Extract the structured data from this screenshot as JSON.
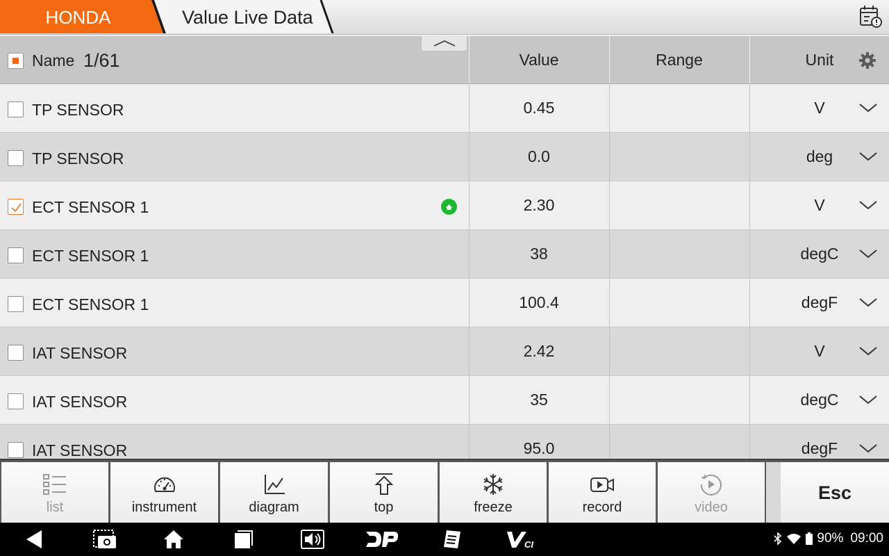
{
  "header": {
    "brand": "HONDA",
    "title": "Value Live Data"
  },
  "table": {
    "columns": {
      "name": "Name",
      "count": "1/61",
      "value": "Value",
      "range": "Range",
      "unit": "Unit"
    },
    "rows": [
      {
        "name": "TP SENSOR",
        "value": "0.45",
        "range": "",
        "unit": "V",
        "checked": false
      },
      {
        "name": "TP SENSOR",
        "value": "0.0",
        "range": "",
        "unit": "deg",
        "checked": false
      },
      {
        "name": "ECT SENSOR 1",
        "value": "2.30",
        "range": "",
        "unit": "V",
        "checked": true
      },
      {
        "name": "ECT SENSOR 1",
        "value": "38",
        "range": "",
        "unit": "degC",
        "checked": false
      },
      {
        "name": "ECT SENSOR 1",
        "value": "100.4",
        "range": "",
        "unit": "degF",
        "checked": false
      },
      {
        "name": "IAT SENSOR",
        "value": "2.42",
        "range": "",
        "unit": "V",
        "checked": false
      },
      {
        "name": "IAT SENSOR",
        "value": "35",
        "range": "",
        "unit": "degC",
        "checked": false
      },
      {
        "name": "IAT SENSOR",
        "value": "95.0",
        "range": "",
        "unit": "degF",
        "checked": false
      }
    ]
  },
  "toolbar": {
    "list": "list",
    "instrument": "instrument",
    "diagram": "diagram",
    "top": "top",
    "freeze": "freeze",
    "record": "record",
    "video": "video",
    "esc": "Esc"
  },
  "statusbar": {
    "battery": "90%",
    "time": "09:00"
  },
  "colors": {
    "accent": "#f36a10",
    "check": "#f07a2c",
    "indicator": "#1fb832"
  }
}
